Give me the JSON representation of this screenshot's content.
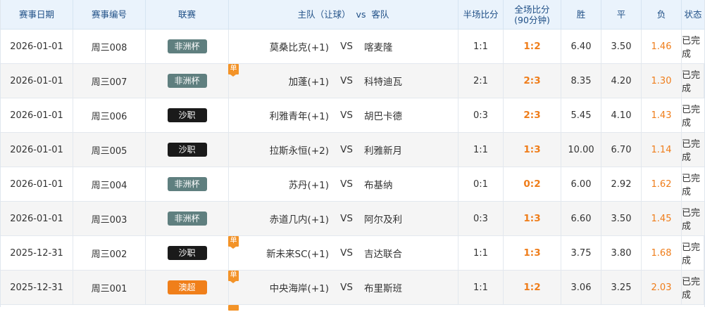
{
  "header": {
    "date": "赛事日期",
    "number": "赛事编号",
    "league": "联赛",
    "match": "主队（让球）  vs  客队",
    "half": "半场比分",
    "full_line1": "全场比分",
    "full_line2": "(90分钟)",
    "win": "胜",
    "draw": "平",
    "lose": "负",
    "status": "状态"
  },
  "colors": {
    "afcon": "#5f7f7f",
    "saudi": "#1a1a1a",
    "aleague": "#f07f1a",
    "highlight": "#ef7d1a",
    "header_bg": "#eaf3fc"
  },
  "single_badge": "单",
  "vs": "VS",
  "rows": [
    {
      "date": "2026-01-01",
      "number": "周三008",
      "league": "非洲杯",
      "league_type": "afcon",
      "home": "莫桑比克(+1)",
      "away": "喀麦隆",
      "half": "1:1",
      "full": "1:2",
      "win": "6.40",
      "draw": "3.50",
      "lose": "1.46",
      "status": "已完成",
      "single": false
    },
    {
      "date": "2026-01-01",
      "number": "周三007",
      "league": "非洲杯",
      "league_type": "afcon",
      "home": "加蓬(+1)",
      "away": "科特迪瓦",
      "half": "2:1",
      "full": "2:3",
      "win": "8.35",
      "draw": "4.20",
      "lose": "1.30",
      "status": "已完成",
      "single": true
    },
    {
      "date": "2026-01-01",
      "number": "周三006",
      "league": "沙职",
      "league_type": "saudi",
      "home": "利雅青年(+1)",
      "away": "胡巴卡德",
      "half": "0:3",
      "full": "2:3",
      "win": "5.45",
      "draw": "4.10",
      "lose": "1.43",
      "status": "已完成",
      "single": false
    },
    {
      "date": "2026-01-01",
      "number": "周三005",
      "league": "沙职",
      "league_type": "saudi",
      "home": "拉斯永恒(+2)",
      "away": "利雅新月",
      "half": "1:1",
      "full": "1:3",
      "win": "10.00",
      "draw": "6.70",
      "lose": "1.14",
      "status": "已完成",
      "single": false
    },
    {
      "date": "2026-01-01",
      "number": "周三004",
      "league": "非洲杯",
      "league_type": "afcon",
      "home": "苏丹(+1)",
      "away": "布基纳",
      "half": "0:1",
      "full": "0:2",
      "win": "6.00",
      "draw": "2.92",
      "lose": "1.62",
      "status": "已完成",
      "single": false
    },
    {
      "date": "2026-01-01",
      "number": "周三003",
      "league": "非洲杯",
      "league_type": "afcon",
      "home": "赤道几内(+1)",
      "away": "阿尔及利",
      "half": "0:3",
      "full": "1:3",
      "win": "6.60",
      "draw": "3.50",
      "lose": "1.45",
      "status": "已完成",
      "single": false
    },
    {
      "date": "2025-12-31",
      "number": "周三002",
      "league": "沙职",
      "league_type": "saudi",
      "home": "新未来SC(+1)",
      "away": "吉达联合",
      "half": "1:1",
      "full": "1:3",
      "win": "3.75",
      "draw": "3.80",
      "lose": "1.68",
      "status": "已完成",
      "single": true
    },
    {
      "date": "2025-12-31",
      "number": "周三001",
      "league": "澳超",
      "league_type": "aleague",
      "home": "中央海岸(+1)",
      "away": "布里斯班",
      "half": "1:1",
      "full": "1:2",
      "win": "3.06",
      "draw": "3.25",
      "lose": "2.03",
      "status": "已完成",
      "single": true
    }
  ]
}
